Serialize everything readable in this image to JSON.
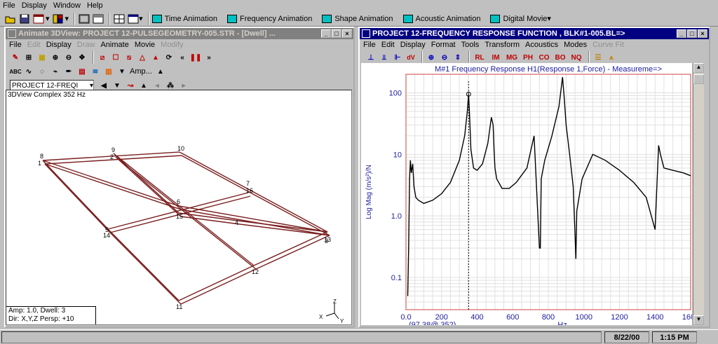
{
  "menu": [
    "File",
    "Display",
    "Window",
    "Help"
  ],
  "toolbar": {
    "animations": [
      "Time Animation",
      "Frequency Animation",
      "Shape Animation",
      "Acoustic Animation",
      "Digital Movie"
    ]
  },
  "left_window": {
    "title": "Animate 3DView: PROJECT 12-PULSEGEOMETRY-005.STR - [Dwell] ...",
    "menu": [
      "File",
      "Edit",
      "Display",
      "Draw",
      "Animate",
      "Movie",
      "Modify"
    ],
    "disabled_menu": [
      "Edit",
      "Draw",
      "Modify"
    ],
    "amp_label": "Amp...",
    "project_combo": "PROJECT 12-FREQI",
    "view_label": "3DView  Complex 352 Hz",
    "status_line1": "Amp: 1.0,  Dwell: 3",
    "status_line2": "Dir: X,Y,Z Persp: +10",
    "axis_labels": [
      "X",
      "Y",
      "Z"
    ],
    "node_labels": [
      "1",
      "2",
      "3",
      "4",
      "5",
      "6",
      "7",
      "8",
      "9",
      "10",
      "11",
      "12",
      "13",
      "14",
      "15",
      "16"
    ],
    "line_color": "#7a1f1f"
  },
  "right_window": {
    "title": "PROJECT 12-FREQUENCY RESPONSE FUNCTION , BLK#1-005.BL=>",
    "menu": [
      "File",
      "Edit",
      "Display",
      "Format",
      "Tools",
      "Transform",
      "Acoustics",
      "Modes",
      "Curve Fit"
    ],
    "disabled_menu": [
      "Curve Fit"
    ],
    "toolbar_labels": [
      "RL",
      "IM",
      "MG",
      "PH",
      "CO",
      "BO",
      "NQ"
    ],
    "cursor_readout": "(97.38@ 352)"
  },
  "chart_data": {
    "type": "line",
    "title": "M#1 Frequency Response H1(Response 1,Force) - Measureme=>",
    "xlabel": "Hz",
    "ylabel": "Log Mag (m/s²)/N",
    "xlim": [
      0,
      1600
    ],
    "ylim": [
      0.03,
      200
    ],
    "yscale": "log",
    "x_ticks": [
      "0.0",
      "200",
      "400",
      "600",
      "800",
      "1000",
      "1200",
      "1400",
      "1600"
    ],
    "y_ticks": [
      "0.1",
      "1.0",
      "10",
      "100"
    ],
    "cursor_x": 352,
    "series": [
      {
        "color": "#000000",
        "x": [
          10,
          15,
          20,
          25,
          30,
          38,
          45,
          55,
          70,
          100,
          150,
          200,
          250,
          300,
          330,
          345,
          352,
          358,
          365,
          380,
          400,
          430,
          460,
          480,
          490,
          495,
          500,
          510,
          540,
          580,
          620,
          680,
          720,
          750,
          755,
          760,
          780,
          820,
          860,
          880,
          890,
          900,
          920,
          940,
          950,
          955,
          960,
          990,
          1050,
          1120,
          1200,
          1280,
          1350,
          1400,
          1410,
          1420,
          1430,
          1450,
          1500,
          1560,
          1600
        ],
        "y": [
          0.05,
          0.3,
          4,
          8,
          5,
          7,
          3,
          2,
          1.8,
          1.6,
          1.8,
          2.3,
          3.5,
          8,
          20,
          50,
          95,
          40,
          12,
          6,
          5.5,
          7,
          15,
          40,
          30,
          12,
          6,
          4,
          2.8,
          2.8,
          3.5,
          6,
          20,
          0.3,
          0.3,
          4,
          8,
          20,
          60,
          180,
          80,
          30,
          10,
          3,
          0.5,
          0.2,
          1.2,
          4,
          10,
          8,
          5.5,
          3.5,
          2,
          0.6,
          3,
          14,
          10,
          6,
          5.5,
          5,
          4.5
        ]
      }
    ]
  },
  "status_bar": {
    "date": "8/22/00",
    "time": "1:15 PM"
  }
}
